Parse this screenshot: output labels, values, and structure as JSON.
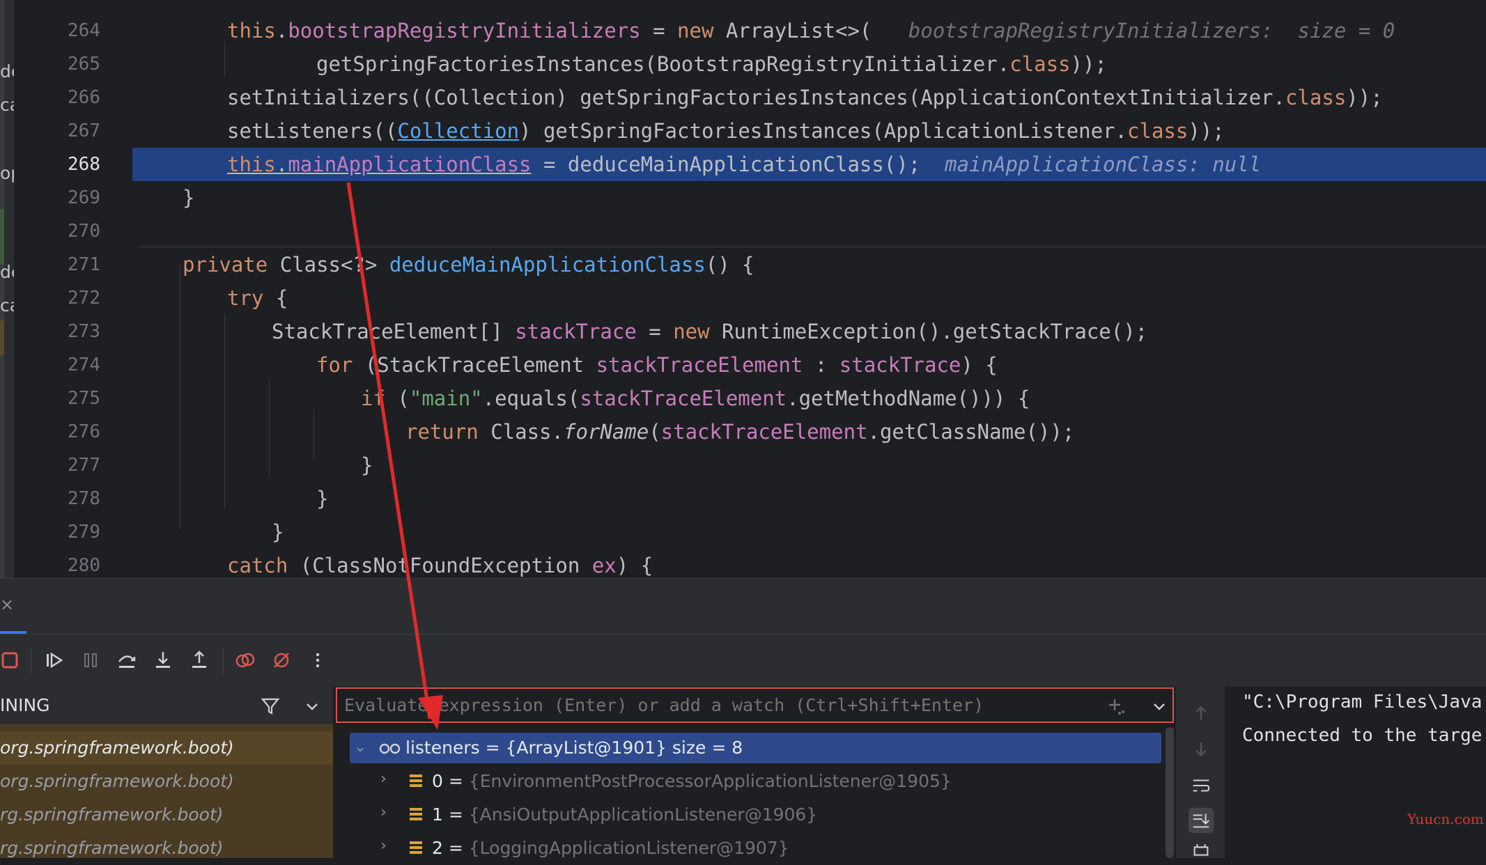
{
  "editor": {
    "left_strip_fragments": [
      "de",
      "ca",
      "op",
      "de",
      "ca"
    ],
    "lines": [
      {
        "num": "264",
        "tokens": [
          {
            "c": "kw",
            "t": "this"
          },
          {
            "c": "",
            "t": "."
          },
          {
            "c": "fld",
            "t": "bootstrapRegistryInitializers"
          },
          {
            "c": "",
            "t": " = "
          },
          {
            "c": "kw",
            "t": "new "
          },
          {
            "c": "",
            "t": "ArrayList<>(   "
          },
          {
            "c": "hint",
            "t": "bootstrapRegistryInitializers:  size = 0"
          }
        ]
      },
      {
        "num": "265",
        "tokens": [
          {
            "c": "",
            "t": "getSpringFactoriesInstances(BootstrapRegistryInitializer."
          },
          {
            "c": "kw",
            "t": "class"
          },
          {
            "c": "",
            "t": "));"
          }
        ]
      },
      {
        "num": "266",
        "tokens": [
          {
            "c": "",
            "t": "setInitializers((Collection) getSpringFactoriesInstances(ApplicationContextInitializer."
          },
          {
            "c": "kw",
            "t": "class"
          },
          {
            "c": "",
            "t": "));"
          }
        ]
      },
      {
        "num": "267",
        "tokens": [
          {
            "c": "",
            "t": "setListeners(("
          },
          {
            "c": "link",
            "t": "Collection"
          },
          {
            "c": "",
            "t": ") getSpringFactoriesInstances(ApplicationListener."
          },
          {
            "c": "kw",
            "t": "class"
          },
          {
            "c": "",
            "t": "));"
          }
        ]
      },
      {
        "num": "268",
        "tokens": [
          {
            "c": "kw ul",
            "t": "this"
          },
          {
            "c": "ul",
            "t": "."
          },
          {
            "c": "fld ul",
            "t": "mainApplicationClass"
          },
          {
            "c": "",
            "t": " = deduceMainApplicationClass();  "
          },
          {
            "c": "hint-sel",
            "t": "mainApplicationClass: null"
          }
        ]
      },
      {
        "num": "269",
        "tokens": [
          {
            "c": "",
            "t": "}"
          }
        ]
      },
      {
        "num": "270",
        "tokens": []
      },
      {
        "num": "271",
        "tokens": [
          {
            "c": "kw",
            "t": "private "
          },
          {
            "c": "",
            "t": "Class<?> "
          },
          {
            "c": "fn",
            "t": "deduceMainApplicationClass"
          },
          {
            "c": "",
            "t": "() {"
          }
        ]
      },
      {
        "num": "272",
        "tokens": [
          {
            "c": "kw",
            "t": "try "
          },
          {
            "c": "",
            "t": "{"
          }
        ]
      },
      {
        "num": "273",
        "tokens": [
          {
            "c": "",
            "t": "StackTraceElement[] "
          },
          {
            "c": "lv",
            "t": "stackTrace"
          },
          {
            "c": "",
            "t": " = "
          },
          {
            "c": "kw",
            "t": "new "
          },
          {
            "c": "",
            "t": "RuntimeException().getStackTrace();"
          }
        ]
      },
      {
        "num": "274",
        "tokens": [
          {
            "c": "kw",
            "t": "for "
          },
          {
            "c": "",
            "t": "(StackTraceElement "
          },
          {
            "c": "lv",
            "t": "stackTraceElement"
          },
          {
            "c": "",
            "t": " : "
          },
          {
            "c": "lv",
            "t": "stackTrace"
          },
          {
            "c": "",
            "t": ") {"
          }
        ]
      },
      {
        "num": "275",
        "tokens": [
          {
            "c": "kw",
            "t": "if "
          },
          {
            "c": "",
            "t": "("
          },
          {
            "c": "str",
            "t": "\"main\""
          },
          {
            "c": "",
            "t": ".equals("
          },
          {
            "c": "lv",
            "t": "stackTraceElement"
          },
          {
            "c": "",
            "t": ".getMethodName())) {"
          }
        ]
      },
      {
        "num": "276",
        "tokens": [
          {
            "c": "kw",
            "t": "return "
          },
          {
            "c": "",
            "t": "Class."
          },
          {
            "c": "it",
            "t": "forName"
          },
          {
            "c": "",
            "t": "("
          },
          {
            "c": "lv",
            "t": "stackTraceElement"
          },
          {
            "c": "",
            "t": ".getClassName());"
          }
        ]
      },
      {
        "num": "277",
        "tokens": [
          {
            "c": "",
            "t": "}"
          }
        ]
      },
      {
        "num": "278",
        "tokens": [
          {
            "c": "",
            "t": "}"
          }
        ]
      },
      {
        "num": "279",
        "tokens": [
          {
            "c": "",
            "t": "}"
          }
        ]
      },
      {
        "num": "280",
        "tokens": [
          {
            "c": "kw",
            "t": "catch "
          },
          {
            "c": "",
            "t": "(ClassNotFoundException "
          },
          {
            "c": "lv",
            "t": "ex"
          },
          {
            "c": "",
            "t": ") {"
          }
        ]
      }
    ]
  },
  "debug": {
    "close_label": "×",
    "frames_title": "INING",
    "frames": [
      "org.springframework.boot)",
      "org.springframework.boot)",
      "rg.springframework.boot)",
      "rg.springframework.boot)"
    ],
    "evaluate_placeholder": "Evaluate expression (Enter) or add a watch (Ctrl+Shift+Enter)",
    "variables": [
      {
        "name": "listeners",
        "value": " = {ArrayList@1901}  size = 8"
      },
      {
        "name": "0",
        "value": "{EnvironmentPostProcessorApplicationListener@1905}"
      },
      {
        "name": "1",
        "value": "{AnsiOutputApplicationListener@1906}"
      },
      {
        "name": "2",
        "value": "{LoggingApplicationListener@1907}"
      }
    ],
    "console": [
      "\"C:\\Program Files\\Java",
      "Connected to the targe"
    ]
  },
  "watermark": "Yuucn.com",
  "colors": {
    "accent": "#3574f0",
    "selection": "#214283",
    "annotation_arrow": "#e02a2a"
  }
}
